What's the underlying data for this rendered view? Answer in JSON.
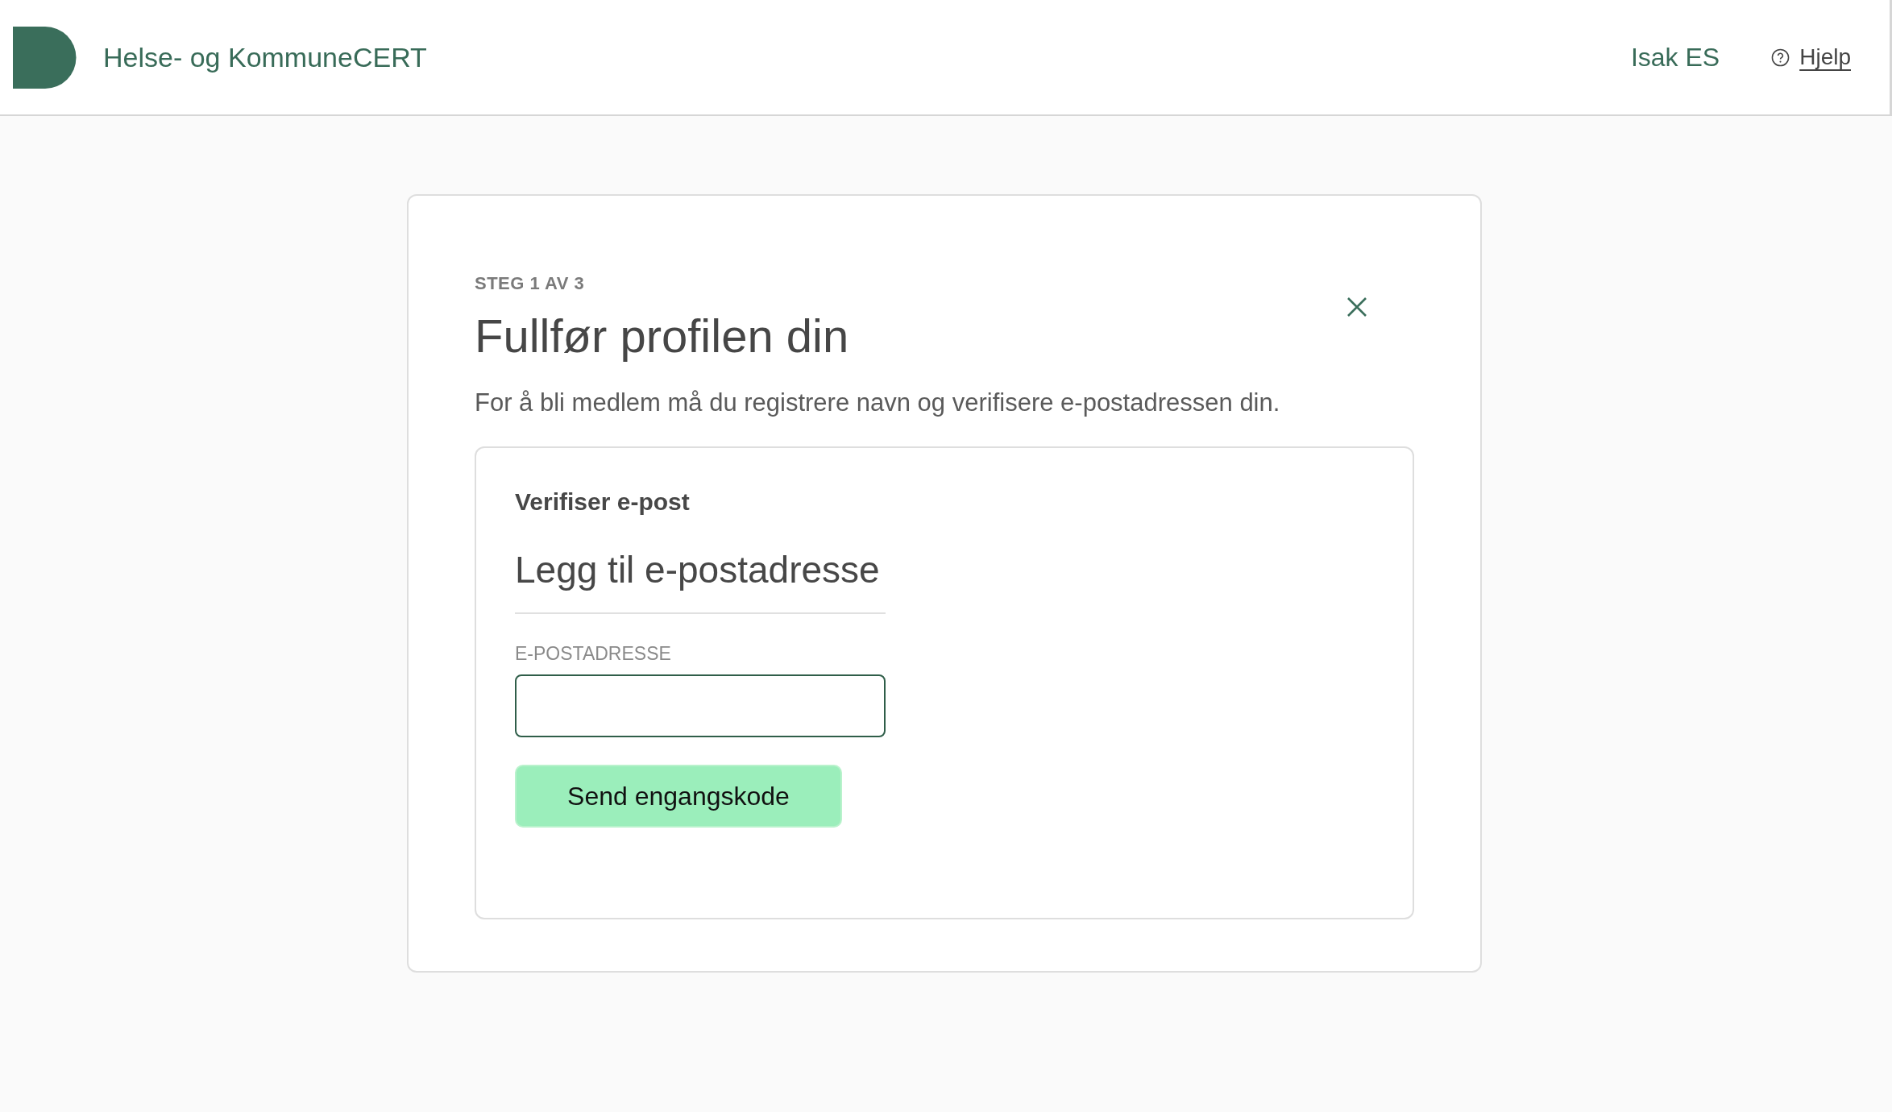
{
  "header": {
    "title": "Helse- og KommuneCERT",
    "user": "Isak ES",
    "help": "Hjelp"
  },
  "dialog": {
    "step": "STEG 1 AV 3",
    "title": "Fullfør profilen din",
    "description": "For å bli medlem må du registrere navn og verifisere e-postadressen din.",
    "section": {
      "heading": "Verifiser e-post",
      "subheading": "Legg til e-postadresse",
      "field": {
        "label": "E-POSTADRESSE"
      },
      "button": "Send engangskode"
    }
  }
}
